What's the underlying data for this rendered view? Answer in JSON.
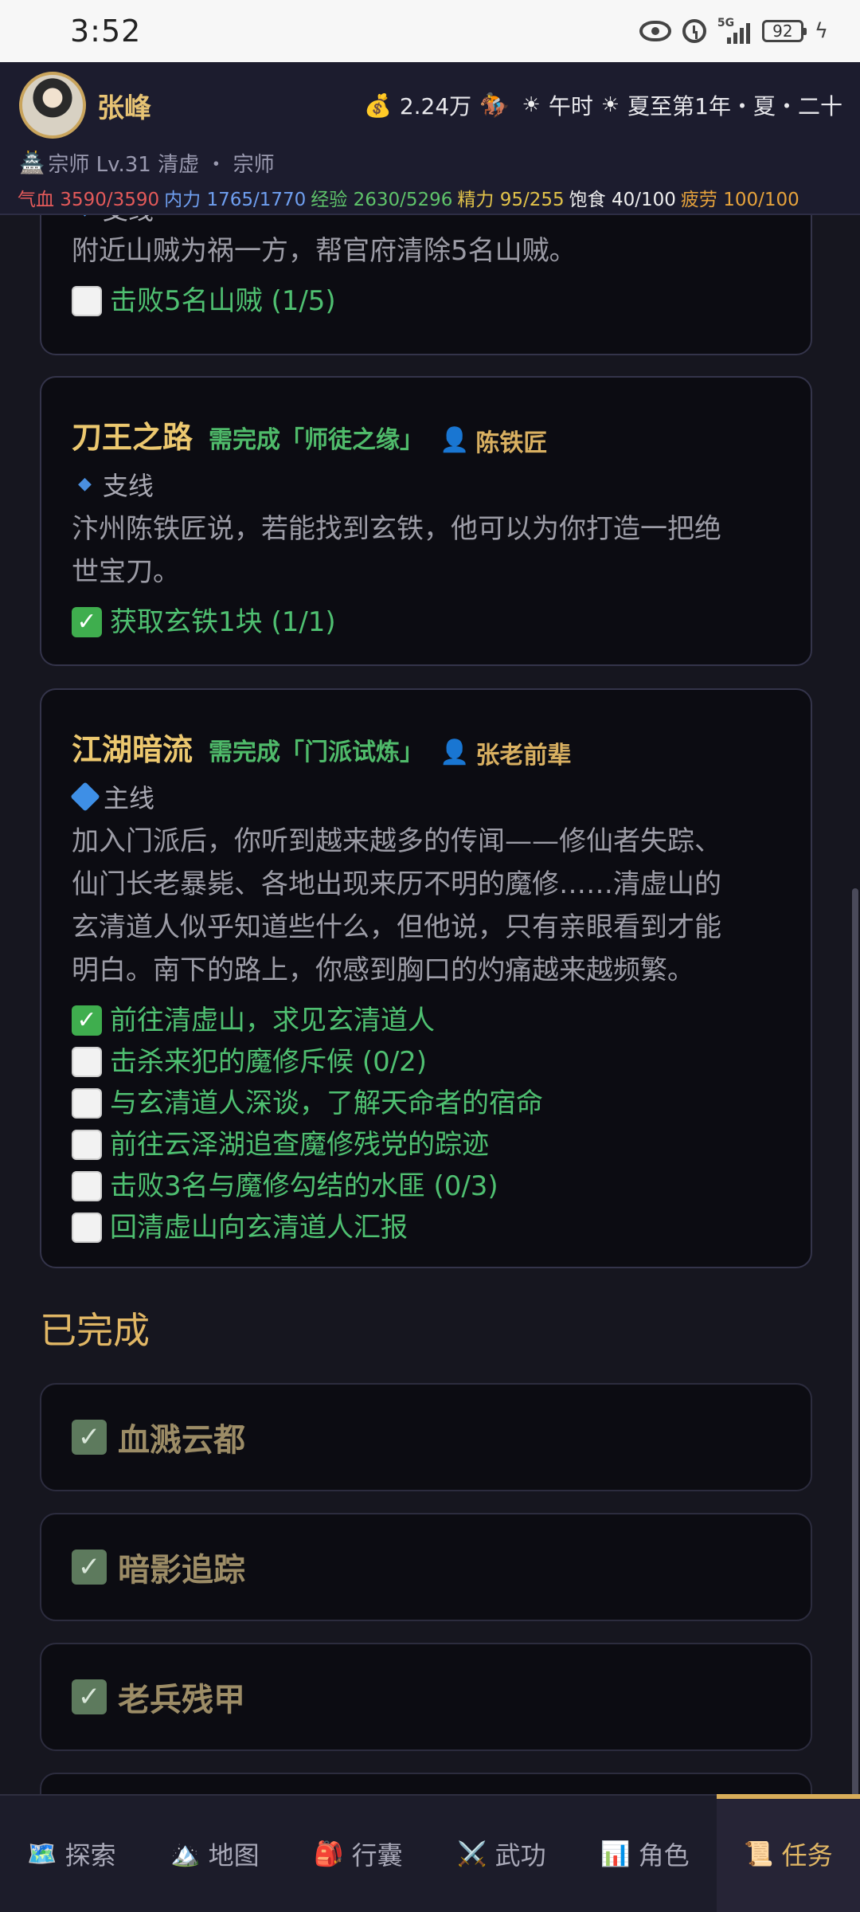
{
  "status_bar": {
    "time": "3:52",
    "network": "5G",
    "battery": "92"
  },
  "player": {
    "name": "张峰",
    "money": "2.24万",
    "time_of_day": "午时",
    "date": "夏至第1年・夏・二十",
    "rank_line": "宗师 Lv.31 清虚 ・ 宗师",
    "stats": {
      "hp": "气血 3590/3590",
      "mp": "内力 1765/1770",
      "exp": "经验 2630/5296",
      "energy": "精力 95/255",
      "food": "饱食 40/100",
      "fatigue": "疲劳 100/100"
    }
  },
  "quests": [
    {
      "title_partial": "支线",
      "desc": "附近山贼为祸一方，帮官府清除5名山贼。",
      "objectives": [
        {
          "done": false,
          "text": "击败5名山贼 (1/5)"
        }
      ]
    },
    {
      "title": "刀王之路",
      "prereq": "需完成「师徒之缘」",
      "giver": "陈铁匠",
      "type": "支线",
      "desc_lines": [
        "汴州陈铁匠说，若能找到玄铁，他可以为你打造一把绝",
        "世宝刀。"
      ],
      "objectives": [
        {
          "done": true,
          "text": "获取玄铁1块 (1/1)"
        }
      ]
    },
    {
      "title": "江湖暗流",
      "prereq": "需完成「门派试炼」",
      "giver": "张老前辈",
      "type": "主线",
      "desc_lines": [
        "加入门派后，你听到越来越多的传闻——修仙者失踪、",
        "仙门长老暴毙、各地出现来历不明的魔修……清虚山的",
        "玄清道人似乎知道些什么，但他说，只有亲眼看到才能",
        "明白。南下的路上，你感到胸口的灼痛越来越频繁。"
      ],
      "objectives": [
        {
          "done": true,
          "text": "前往清虚山，求见玄清道人"
        },
        {
          "done": false,
          "text": "击杀来犯的魔修斥候 (0/2)"
        },
        {
          "done": false,
          "text": "与玄清道人深谈，了解天命者的宿命"
        },
        {
          "done": false,
          "text": "前往云泽湖追查魔修残党的踪迹"
        },
        {
          "done": false,
          "text": "击败3名与魔修勾结的水匪 (0/3)"
        },
        {
          "done": false,
          "text": "回清虚山向玄清道人汇报"
        }
      ]
    }
  ],
  "completed_section": {
    "title": "已完成",
    "items": [
      "血溅云都",
      "暗影追踪",
      "老兵残甲"
    ]
  },
  "nav": {
    "tabs": [
      {
        "label": "探索",
        "icon": "🗺️"
      },
      {
        "label": "地图",
        "icon": "🏔️"
      },
      {
        "label": "行囊",
        "icon": "🎒"
      },
      {
        "label": "武功",
        "icon": "⚔️"
      },
      {
        "label": "角色",
        "icon": "📊"
      },
      {
        "label": "任务",
        "icon": "📜"
      }
    ],
    "active": "任务"
  }
}
